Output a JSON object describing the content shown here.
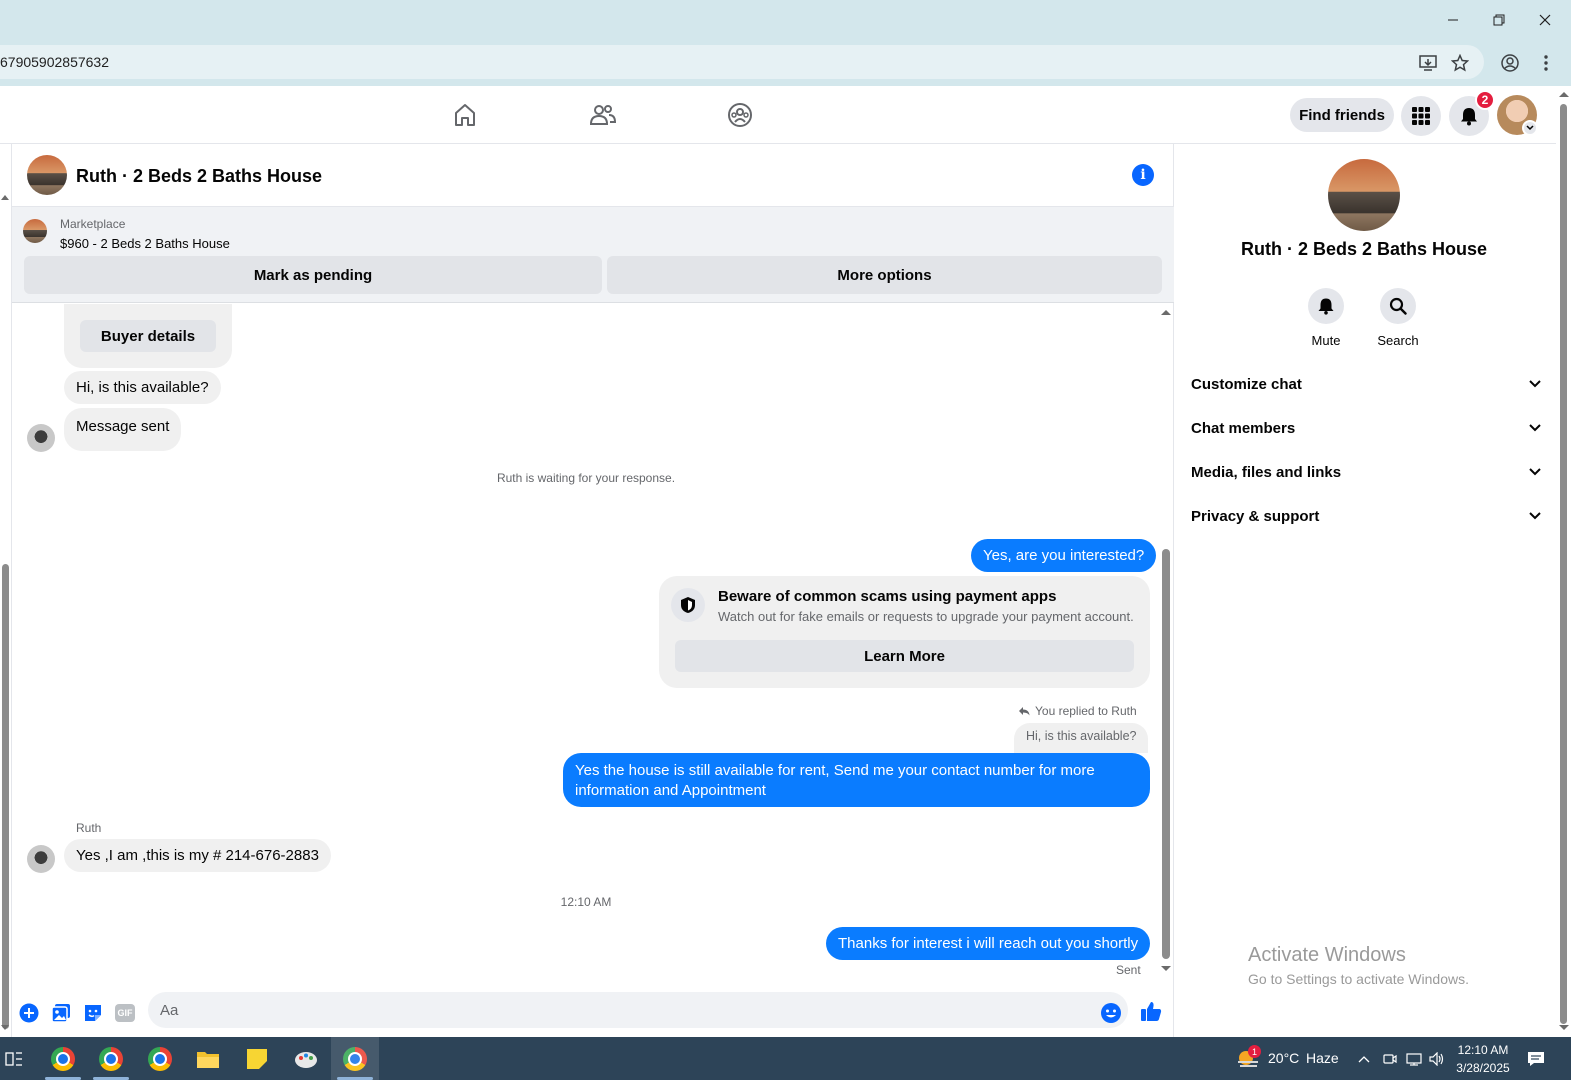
{
  "browser": {
    "url": "67905902857632"
  },
  "nav": {
    "find_friends": "Find friends",
    "notification_count": "2"
  },
  "chat": {
    "title": "Ruth · 2 Beds 2 Baths House",
    "marketplace_label": "Marketplace",
    "listing": "$960 - 2 Beds 2 Baths House",
    "mark_pending": "Mark as pending",
    "more_options": "More options",
    "buyer_details": "Buyer details",
    "msg_available": "Hi, is this available?",
    "msg_sent": "Message sent",
    "waiting_note": "Ruth is waiting for your response.",
    "out_interested": "Yes, are you interested?",
    "scam_title": "Beware of common scams using payment apps",
    "scam_sub": "Watch out for fake emails or requests to upgrade your payment account.",
    "learn_more": "Learn More",
    "replied_to": "You replied to Ruth",
    "quoted": "Hi, is this available?",
    "out_house": "Yes the house is still available for rent, Send me your contact number for more information and Appointment",
    "sender_name": "Ruth",
    "in_number": "Yes ,I am ,this is my # 214-676-2883",
    "timestamp": "12:10 AM",
    "out_thanks": "Thanks for interest i will reach out you shortly",
    "status": "Sent",
    "composer_placeholder": "Aa",
    "gif_label": "GIF"
  },
  "panel": {
    "title": "Ruth · 2 Beds 2 Baths House",
    "mute": "Mute",
    "search": "Search",
    "sections": [
      "Customize chat",
      "Chat members",
      "Media, files and links",
      "Privacy & support"
    ],
    "watermark_title": "Activate Windows",
    "watermark_sub": "Go to Settings to activate Windows."
  },
  "taskbar": {
    "weather_temp": "20°C",
    "weather_cond": "Haze",
    "weather_badge": "1",
    "time": "12:10 AM",
    "date": "3/28/2025"
  },
  "colors": {
    "accent": "#0866ff",
    "out_bubble": "#0a7cff",
    "in_bubble": "#f0f0f0",
    "chrome_bg": "#d3e7ec",
    "taskbar": "#2d4458",
    "badge": "#e41e3f"
  }
}
